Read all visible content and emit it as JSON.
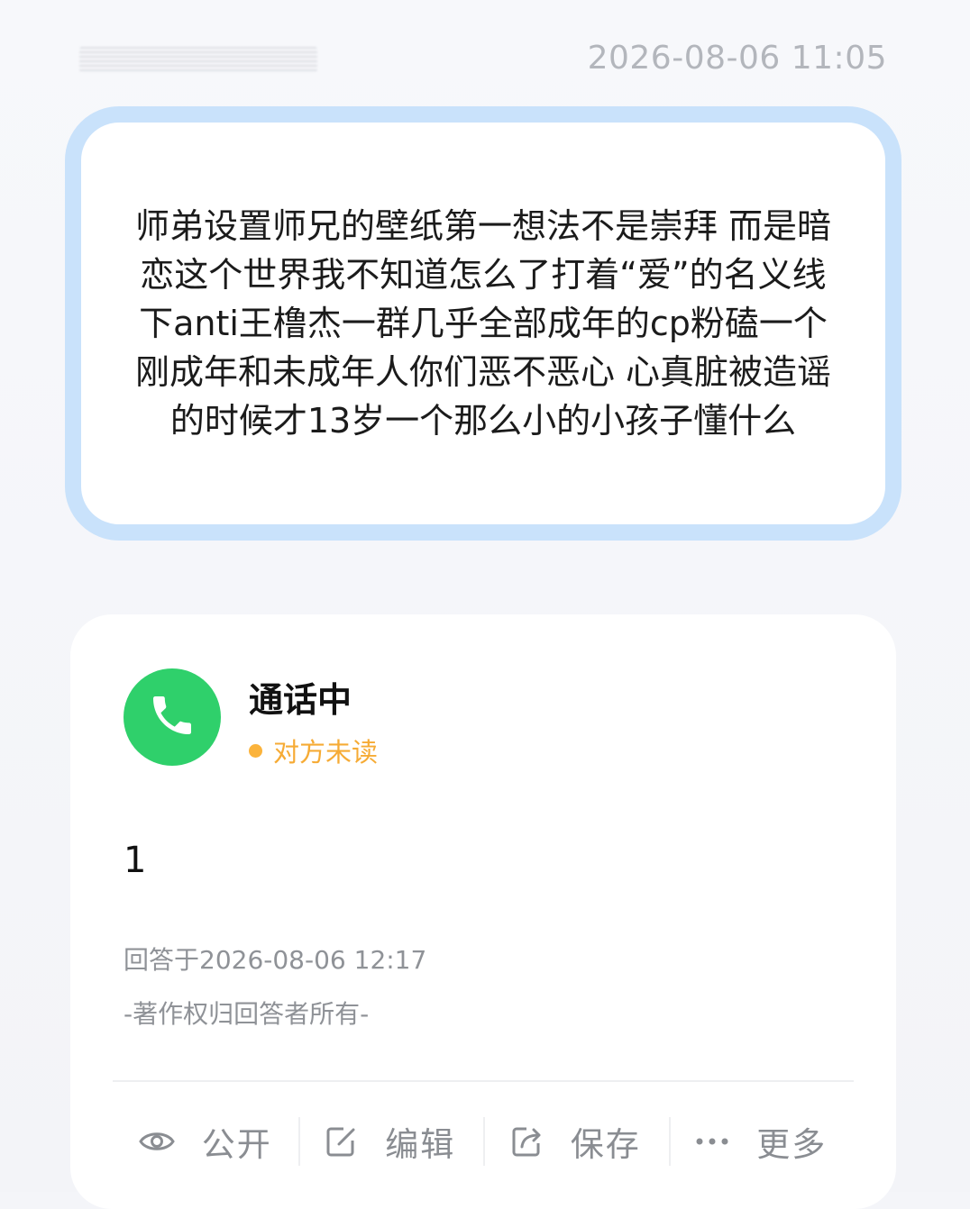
{
  "header": {
    "timestamp": "2026-08-06 11:05"
  },
  "question": {
    "text": "师弟设置师兄的壁纸第一想法不是崇拜 而是暗恋这个世界我不知道怎么了打着“爱”的名义线下anti王橹杰一群几乎全部成年的cp粉磕一个刚成年和未成年人你们恶不恶心 心真脏被造谣的时候才13岁一个那么小的小孩子懂什么"
  },
  "answer": {
    "avatar_icon": "phone-icon",
    "answerer_name": "通话中",
    "read_status": "对方未读",
    "body": "1",
    "answered_at": "回答于2026-08-06 12:17",
    "copyright": "-著作权归回答者所有-"
  },
  "actions": [
    {
      "label": "公开",
      "icon": "eye-icon"
    },
    {
      "label": "编辑",
      "icon": "edit-icon"
    },
    {
      "label": "保存",
      "icon": "share-icon"
    },
    {
      "label": "更多",
      "icon": "more-icon"
    }
  ],
  "colors": {
    "accent_border": "#c9e2fb",
    "avatar_green": "#2fd06b",
    "status_orange": "#f6ab35",
    "muted_text": "#8f9297"
  }
}
